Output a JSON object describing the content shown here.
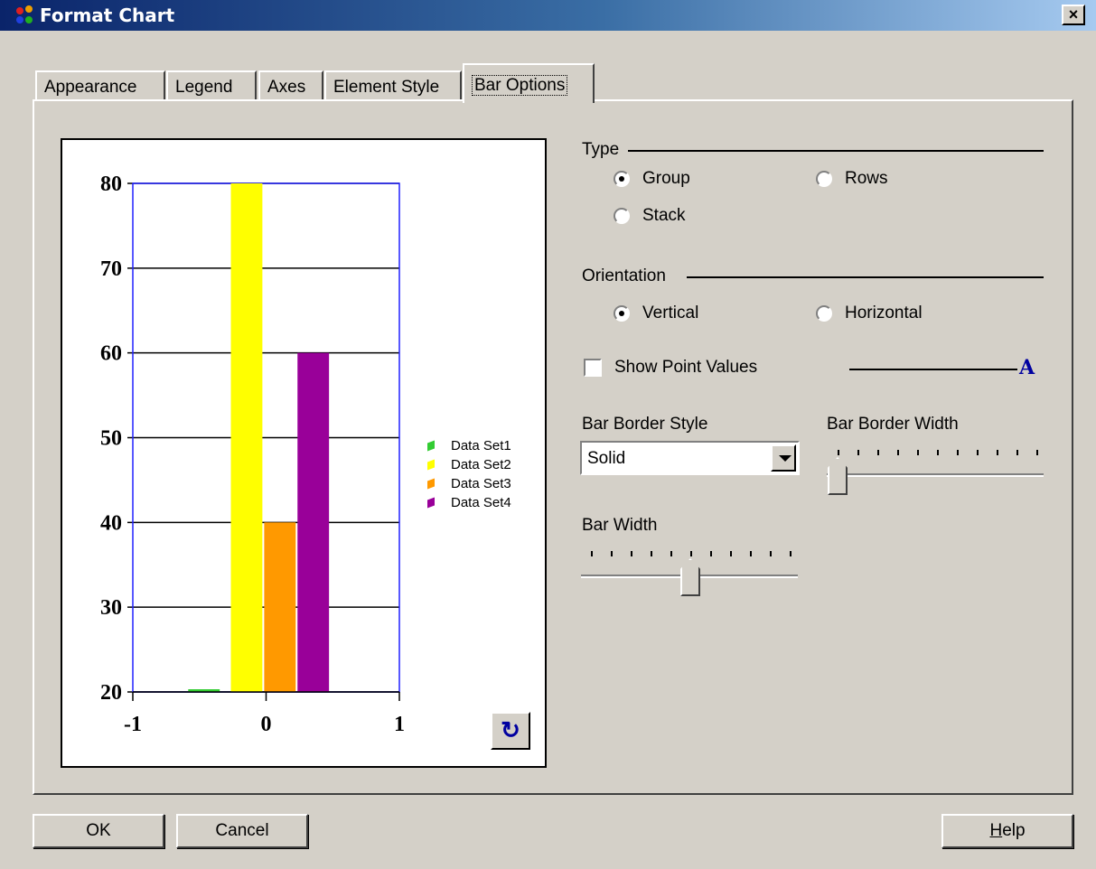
{
  "window": {
    "title": "Format Chart",
    "close_label": "×"
  },
  "tabs": [
    {
      "label": "Appearance"
    },
    {
      "label": "Legend"
    },
    {
      "label": "Axes"
    },
    {
      "label": "Element Style"
    },
    {
      "label": "Bar Options",
      "active": true
    }
  ],
  "chart_data": {
    "type": "bar",
    "x_ticks": [
      "-1",
      "0",
      "1"
    ],
    "y_ticks": [
      "80",
      "70",
      "60",
      "50",
      "40",
      "30",
      "20"
    ],
    "xlim": [
      -1,
      1
    ],
    "ylim": [
      20,
      80
    ],
    "grid": true,
    "legend_position": "right",
    "series": [
      {
        "name": "Data Set1",
        "value": 20,
        "color": "#33cc33"
      },
      {
        "name": "Data Set2",
        "value": 80,
        "color": "#ffff00"
      },
      {
        "name": "Data Set3",
        "value": 40,
        "color": "#ff9900"
      },
      {
        "name": "Data Set4",
        "value": 60,
        "color": "#990099"
      }
    ]
  },
  "chart_refresh_icon": "refresh-icon",
  "type_group": {
    "label": "Type",
    "options": [
      {
        "label": "Group",
        "checked": true
      },
      {
        "label": "Rows",
        "checked": false
      },
      {
        "label": "Stack",
        "checked": false
      }
    ]
  },
  "orientation_group": {
    "label": "Orientation",
    "options": [
      {
        "label": "Vertical",
        "checked": true
      },
      {
        "label": "Horizontal",
        "checked": false
      }
    ]
  },
  "show_point_values": {
    "label": "Show Point Values",
    "checked": false,
    "font_icon": "A"
  },
  "bar_border_style": {
    "label": "Bar Border Style",
    "value": "Solid"
  },
  "bar_border_width": {
    "label": "Bar Border Width",
    "level": 0
  },
  "bar_width": {
    "label": "Bar Width",
    "level": 0.5
  },
  "buttons": {
    "ok": "OK",
    "cancel": "Cancel",
    "help_prefix": "",
    "help_underlined": "H",
    "help_rest": "elp"
  }
}
